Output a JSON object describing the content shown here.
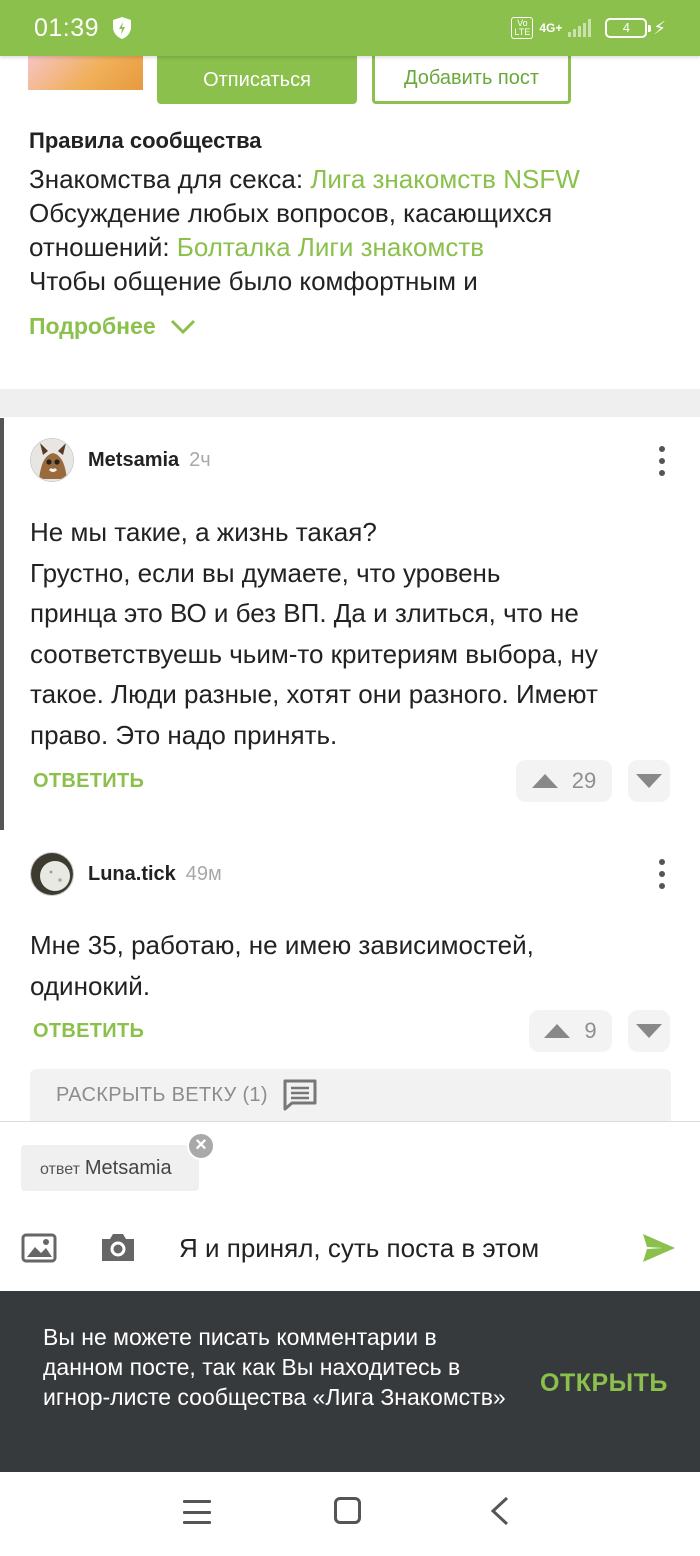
{
  "status_bar": {
    "time": "01:39",
    "volte": "Vo LTE",
    "network": "4G+",
    "battery": "4"
  },
  "community": {
    "unsubscribe_label": "Отписаться",
    "add_post_label": "Добавить пост",
    "rules_title": "Правила сообщества",
    "rules_line1_text": "Знакомства для секса: ",
    "rules_line1_link": "Лига знакомств NSFW",
    "rules_line2_text": "Обсуждение любых вопросов, касающихся отношений: ",
    "rules_line2_link": "Болталка Лиги знакомств",
    "rules_line3_text": "Чтобы общение было комфортным и",
    "more_label": "Подробнее"
  },
  "comments": [
    {
      "author": "Metsamia",
      "time": "2ч",
      "text_lines": [
        "Не мы такие, а жизнь такая?",
        "Грустно, если вы думаете, что уровень",
        "принца это ВО и без ВП. Да и злиться, что не",
        "соответствуешь чьим-то критериям выбора, ну",
        "такое. Люди разные, хотят они разного. Имеют",
        "право. Это надо принять."
      ],
      "reply_label": "ОТВЕТИТЬ",
      "score": "29"
    },
    {
      "author": "Luna.tick",
      "time": "49м",
      "text_lines": [
        "Мне 35, работаю, не имею зависимостей,",
        "одинокий."
      ],
      "reply_label": "ОТВЕТИТЬ",
      "score": "9"
    }
  ],
  "expand_thread_label": "РАСКРЫТЬ ВЕТКУ (1)",
  "composer": {
    "reply_prefix": "ответ",
    "reply_to": "Metsamia",
    "close_glyph": "×",
    "input_value": "Я и принял, суть поста в этом"
  },
  "snackbar": {
    "message": "Вы не можете писать комментарии в данном посте, так как Вы находитесь в игнор-листе сообщества «Лига Знакомств»",
    "action_label": "ОТКРЫТЬ"
  },
  "colors": {
    "accent": "#8ac04b",
    "snackbar_bg": "#373a3c"
  },
  "icons": [
    "shield-icon",
    "signal-icon",
    "battery-icon",
    "chevron-down-icon",
    "more-vert-icon",
    "upvote-icon",
    "downvote-icon",
    "comments-icon",
    "image-icon",
    "camera-icon",
    "send-icon",
    "close-icon",
    "menu-icon",
    "home-icon",
    "back-icon"
  ]
}
